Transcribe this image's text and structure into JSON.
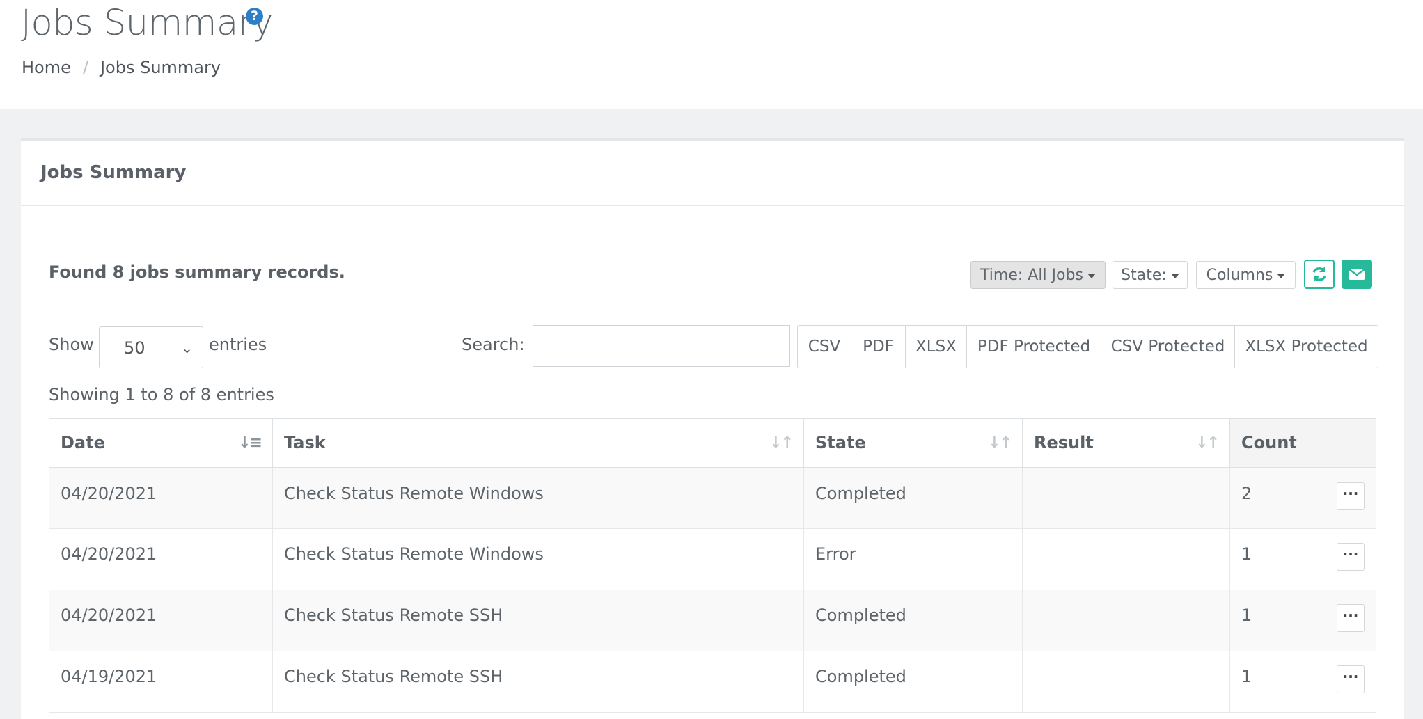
{
  "header": {
    "title": "Jobs Summary",
    "breadcrumb": [
      "Home",
      "Jobs Summary"
    ]
  },
  "card": {
    "title": "Jobs Summary",
    "found_text": "Found 8 jobs summary records.",
    "filters": {
      "time_label": "Time: All Jobs",
      "state_label": "State:",
      "columns_label": "Columns"
    },
    "show_label": "Show",
    "entries_label": "entries",
    "page_length": "50",
    "search_label": "Search:",
    "search_value": "",
    "exports": [
      "CSV",
      "PDF",
      "XLSX",
      "PDF Protected",
      "CSV Protected",
      "XLSX Protected"
    ],
    "showing_text": "Showing 1 to 8 of 8 entries"
  },
  "table": {
    "columns": [
      "Date",
      "Task",
      "State",
      "Result",
      "Count"
    ],
    "rows": [
      {
        "date": "04/20/2021",
        "task": "Check Status Remote Windows",
        "state": "Completed",
        "result": "",
        "count": "2"
      },
      {
        "date": "04/20/2021",
        "task": "Check Status Remote Windows",
        "state": "Error",
        "result": "",
        "count": "1"
      },
      {
        "date": "04/20/2021",
        "task": "Check Status Remote SSH",
        "state": "Completed",
        "result": "",
        "count": "1"
      },
      {
        "date": "04/19/2021",
        "task": "Check Status Remote SSH",
        "state": "Completed",
        "result": "",
        "count": "1"
      }
    ]
  },
  "icons": {
    "help": "question-circle-icon",
    "refresh": "refresh-icon",
    "email": "envelope-icon",
    "more": "ellipsis-icon",
    "sort": "sort-icon"
  },
  "colors": {
    "accent_green": "#26b99a",
    "help_blue": "#2d80c7"
  }
}
